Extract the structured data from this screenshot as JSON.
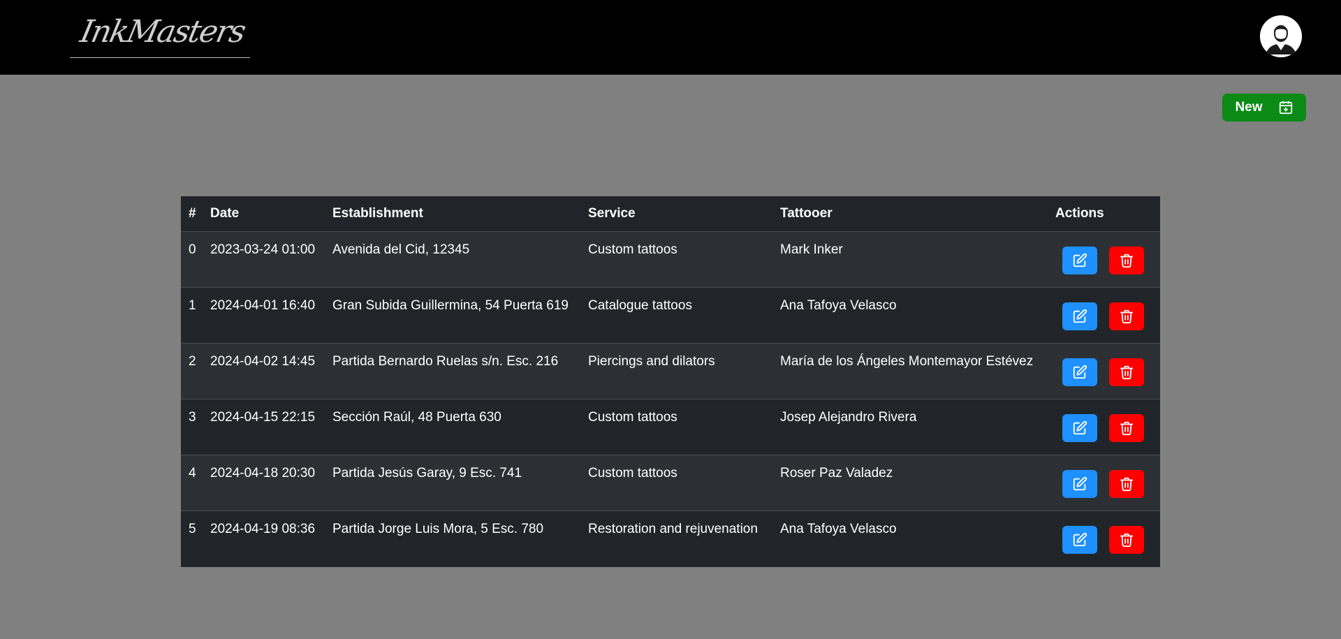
{
  "header": {
    "brand": "InkMasters",
    "avatar_icon": "user-avatar-icon"
  },
  "toolbar": {
    "new_label": "New",
    "new_icon": "calendar-plus-icon",
    "new_color": "#0b8a16"
  },
  "table": {
    "columns": [
      "#",
      "Date",
      "Establishment",
      "Service",
      "Tattooer",
      "Actions"
    ],
    "rows": [
      {
        "id": "0",
        "date": "2023-03-24 01:00",
        "establishment": "Avenida del Cid, 12345",
        "service": "Custom tattoos",
        "tattooer": "Mark Inker"
      },
      {
        "id": "1",
        "date": "2024-04-01 16:40",
        "establishment": "Gran Subida Guillermina, 54 Puerta 619",
        "service": "Catalogue tattoos",
        "tattooer": "Ana Tafoya Velasco"
      },
      {
        "id": "2",
        "date": "2024-04-02 14:45",
        "establishment": "Partida Bernardo Ruelas s/n. Esc. 216",
        "service": "Piercings and dilators",
        "tattooer": "María de los Ángeles Montemayor Estévez"
      },
      {
        "id": "3",
        "date": "2024-04-15 22:15",
        "establishment": "Sección Raúl, 48 Puerta 630",
        "service": "Custom tattoos",
        "tattooer": "Josep Alejandro Rivera"
      },
      {
        "id": "4",
        "date": "2024-04-18 20:30",
        "establishment": "Partida Jesús Garay, 9 Esc. 741",
        "service": "Custom tattoos",
        "tattooer": "Roser Paz Valadez"
      },
      {
        "id": "5",
        "date": "2024-04-19 08:36",
        "establishment": "Partida Jorge Luis Mora, 5 Esc. 780",
        "service": "Restoration and rejuvenation",
        "tattooer": "Ana Tafoya Velasco"
      }
    ],
    "edit_icon": "edit-icon",
    "delete_icon": "trash-icon",
    "edit_color": "#1e90ff",
    "delete_color": "#ff0000"
  }
}
